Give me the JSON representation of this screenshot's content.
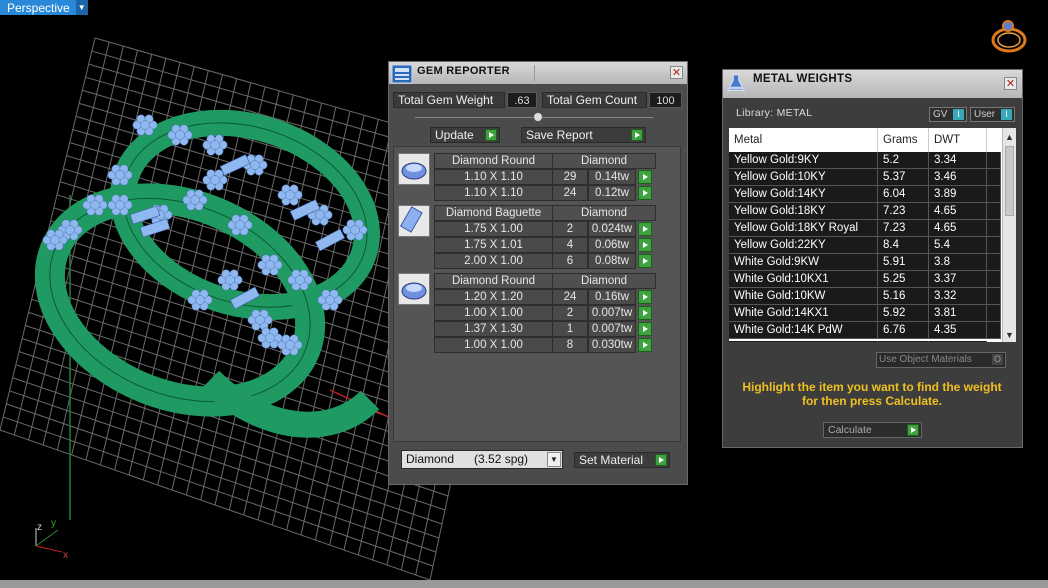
{
  "viewport": {
    "label": "Perspective",
    "axis_labels": {
      "x": "x",
      "y": "y",
      "z": "z"
    }
  },
  "gem_reporter": {
    "title": "GEM REPORTER",
    "total_weight_label": "Total Gem Weight",
    "total_weight_value": ".63",
    "total_count_label": "Total Gem Count",
    "total_count_value": "100",
    "update_label": "Update",
    "save_report_label": "Save Report",
    "groups": [
      {
        "icon": "round-gem-icon",
        "shape": "Diamond Round",
        "material": "Diamond",
        "rows": [
          {
            "size": "1.10 X 1.10",
            "count": "29",
            "weight": "0.14tw"
          },
          {
            "size": "1.10 X 1.10",
            "count": "24",
            "weight": "0.12tw"
          }
        ]
      },
      {
        "icon": "baguette-gem-icon",
        "shape": "Diamond Baguette",
        "material": "Diamond",
        "rows": [
          {
            "size": "1.75 X 1.00",
            "count": "2",
            "weight": "0.024tw"
          },
          {
            "size": "1.75 X 1.01",
            "count": "4",
            "weight": "0.06tw"
          },
          {
            "size": "2.00 X 1.00",
            "count": "6",
            "weight": "0.08tw"
          }
        ]
      },
      {
        "icon": "round-gem-icon",
        "shape": "Diamond Round",
        "material": "Diamond",
        "rows": [
          {
            "size": "1.20 X 1.20",
            "count": "24",
            "weight": "0.16tw"
          },
          {
            "size": "1.00 X 1.00",
            "count": "2",
            "weight": "0.007tw"
          },
          {
            "size": "1.37 X 1.30",
            "count": "1",
            "weight": "0.007tw"
          },
          {
            "size": "1.00 X 1.00",
            "count": "8",
            "weight": "0.030tw"
          }
        ]
      }
    ],
    "material_select": "Diamond      (3.52 spg)",
    "set_material_label": "Set Material"
  },
  "metal_weights": {
    "title": "METAL WEIGHTS",
    "library_label": "Library: METAL",
    "gv_label": "GV",
    "user_label": "User",
    "columns": [
      "Metal",
      "Grams",
      "DWT"
    ],
    "rows": [
      [
        "Yellow Gold:9KY",
        "5.2",
        "3.34"
      ],
      [
        "Yellow Gold:10KY",
        "5.37",
        "3.46"
      ],
      [
        "Yellow Gold:14KY",
        "6.04",
        "3.89"
      ],
      [
        "Yellow Gold:18KY",
        "7.23",
        "4.65"
      ],
      [
        "Yellow Gold:18KY Royal",
        "7.23",
        "4.65"
      ],
      [
        "Yellow Gold:22KY",
        "8.4",
        "5.4"
      ],
      [
        "White Gold:9KW",
        "5.91",
        "3.8"
      ],
      [
        "White Gold:10KX1",
        "5.25",
        "3.37"
      ],
      [
        "White Gold:10KW",
        "5.16",
        "3.32"
      ],
      [
        "White Gold:14KX1",
        "5.92",
        "3.81"
      ],
      [
        "White Gold:14K PdW",
        "6.76",
        "4.35"
      ]
    ],
    "use_object_materials_label": "Use Object Materials",
    "instruction": "Highlight the item you want to find the weight for then press Calculate.",
    "calculate_label": "Calculate"
  },
  "colors": {
    "ring_green": "#1f9a62",
    "gem_blue": "#8fb8f0",
    "accent_blue": "#2a88d8",
    "instruction_yellow": "#f0c020",
    "button_green": "#3ea23e"
  }
}
